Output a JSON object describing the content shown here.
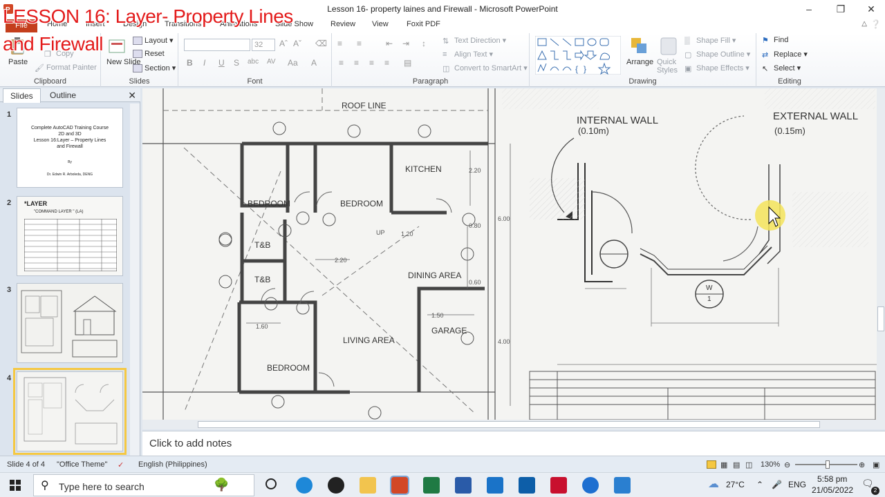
{
  "window": {
    "title": "Lesson  16- property laines  and  Firewall  -  Microsoft PowerPoint"
  },
  "overlay": {
    "line1": "LESSON 16: Layer- Property Lines",
    "line2": "and Firewall"
  },
  "tabs": [
    "File",
    "Home",
    "Insert",
    "Design",
    "Transitions",
    "Animations",
    "Slide Show",
    "Review",
    "View",
    "Foxit PDF"
  ],
  "ribbon": {
    "clipboard": {
      "label": "Clipboard",
      "paste": "Paste",
      "copy": "Copy",
      "format_painter": "Format Painter"
    },
    "slides": {
      "label": "Slides",
      "new_slide": "New Slide",
      "layout": "Layout",
      "reset": "Reset",
      "section": "Section"
    },
    "font": {
      "label": "Font",
      "font_size": "32"
    },
    "paragraph": {
      "label": "Paragraph",
      "text_direction": "Text Direction",
      "align_text": "Align Text",
      "convert": "Convert to SmartArt"
    },
    "drawing": {
      "label": "Drawing",
      "arrange": "Arrange",
      "quick_styles": "Quick Styles",
      "shape_fill": "Shape Fill",
      "shape_outline": "Shape Outline",
      "shape_effects": "Shape Effects"
    },
    "editing": {
      "label": "Editing",
      "find": "Find",
      "replace": "Replace",
      "select": "Select"
    }
  },
  "panel": {
    "tab_slides": "Slides",
    "tab_outline": "Outline",
    "slides": [
      {
        "num": "1",
        "lines": [
          "Complete  AutoCAD Training Course",
          "2D and 3D",
          "Lesson  16:Layer – Property Lines",
          "and  Firewall",
          "By",
          "Dr. Edwin R. Arboleda, DENG"
        ]
      },
      {
        "num": "2",
        "heading": "*LAYER",
        "sub": "\"COMMAND LAYER \" (LA)"
      },
      {
        "num": "3"
      },
      {
        "num": "4"
      }
    ]
  },
  "plan": {
    "roof_line": "ROOF LINE",
    "kitchen": "KITCHEN",
    "bedroom1": "BEDROOM",
    "bedroom2": "BEDROOM",
    "bedroom3": "BEDROOM",
    "tb1": "T&B",
    "tb2": "T&B",
    "dining": "DINING AREA",
    "garage": "GARAGE",
    "living": "LIVING AREA",
    "internal_wall": "INTERNAL WALL",
    "internal_wall_dim": "(0.10m)",
    "external_wall": "EXTERNAL WALL",
    "external_wall_dim": "(0.15m)",
    "d1": "2.20",
    "d2": "0.80",
    "d3": "6.00",
    "d4": "1.20",
    "d5": "2.20",
    "d6": "0.60",
    "d7": "1.50",
    "d8": "4.00",
    "d9": "1.60",
    "up": "UP",
    "w_tag": "W",
    "w_num": "1"
  },
  "notes": {
    "placeholder": "Click to add notes"
  },
  "status": {
    "slide": "Slide 4 of 4",
    "theme": "\"Office Theme\"",
    "language": "English (Philippines)",
    "zoom": "130%"
  },
  "taskbar": {
    "search_placeholder": "Type here to search",
    "weather": "27°C",
    "lang": "ENG",
    "time": "5:58 pm",
    "date": "21/05/2022",
    "notif": "2"
  },
  "colors": {
    "file_tab": "#c43e1c",
    "overlay_text": "#e31b1b",
    "selected_thumb": "#f5c842",
    "cursor_highlight": "#f3e35a"
  }
}
